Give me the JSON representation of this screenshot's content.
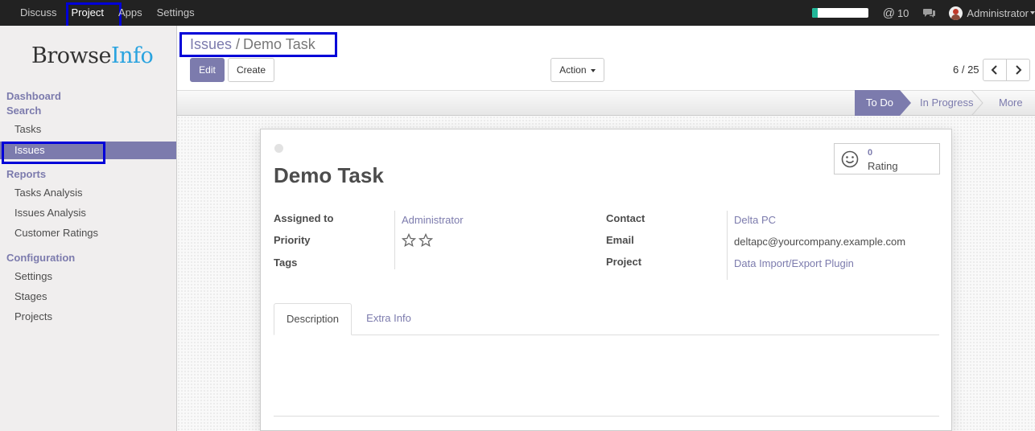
{
  "topbar": {
    "menu": [
      {
        "label": "Discuss",
        "active": false
      },
      {
        "label": "Project",
        "active": true
      },
      {
        "label": "Apps",
        "active": false
      },
      {
        "label": "Settings",
        "active": false
      }
    ],
    "progress_fraction": 0.1,
    "mention_count": "10",
    "user_name": "Administrator",
    "icons": [
      "at-icon",
      "chat-icon",
      "avatar",
      "caret-down-icon"
    ]
  },
  "sidebar": {
    "logo_main": "Browse",
    "logo_accent": "Info",
    "sections": [
      {
        "title": "Dashboard"
      },
      {
        "title": "Search",
        "items": [
          "Tasks",
          "Issues"
        ]
      },
      {
        "title": "Reports",
        "items": [
          "Tasks Analysis",
          "Issues Analysis",
          "Customer Ratings"
        ]
      },
      {
        "title": "Configuration",
        "items": [
          "Settings",
          "Stages",
          "Projects"
        ]
      }
    ],
    "active_item": "Issues"
  },
  "control_panel": {
    "breadcrumb_parent": "Issues",
    "breadcrumb_separator": "/",
    "breadcrumb_current": "Demo Task",
    "edit_label": "Edit",
    "create_label": "Create",
    "action_label": "Action",
    "pager_value": "6 / 25"
  },
  "statusbar": {
    "stages": [
      "To Do",
      "In Progress",
      "More"
    ],
    "current_stage": "To Do"
  },
  "form": {
    "title": "Demo Task",
    "rating_count": "0",
    "rating_label": "Rating",
    "assigned_to_label": "Assigned to",
    "assigned_to_value": "Administrator",
    "priority_label": "Priority",
    "priority_stars": 2,
    "priority_value": 0,
    "tags_label": "Tags",
    "contact_label": "Contact",
    "contact_value": "Delta PC",
    "email_label": "Email",
    "email_value": "deltapc@yourcompany.example.com",
    "project_label": "Project",
    "project_value": "Data Import/Export Plugin",
    "tabs": [
      "Description",
      "Extra Info"
    ],
    "active_tab": "Description"
  },
  "colors": {
    "accent": "#7c7bad",
    "topbar": "#222222",
    "highlight_border": "#0000d8",
    "progress_fill": "#21b799"
  }
}
